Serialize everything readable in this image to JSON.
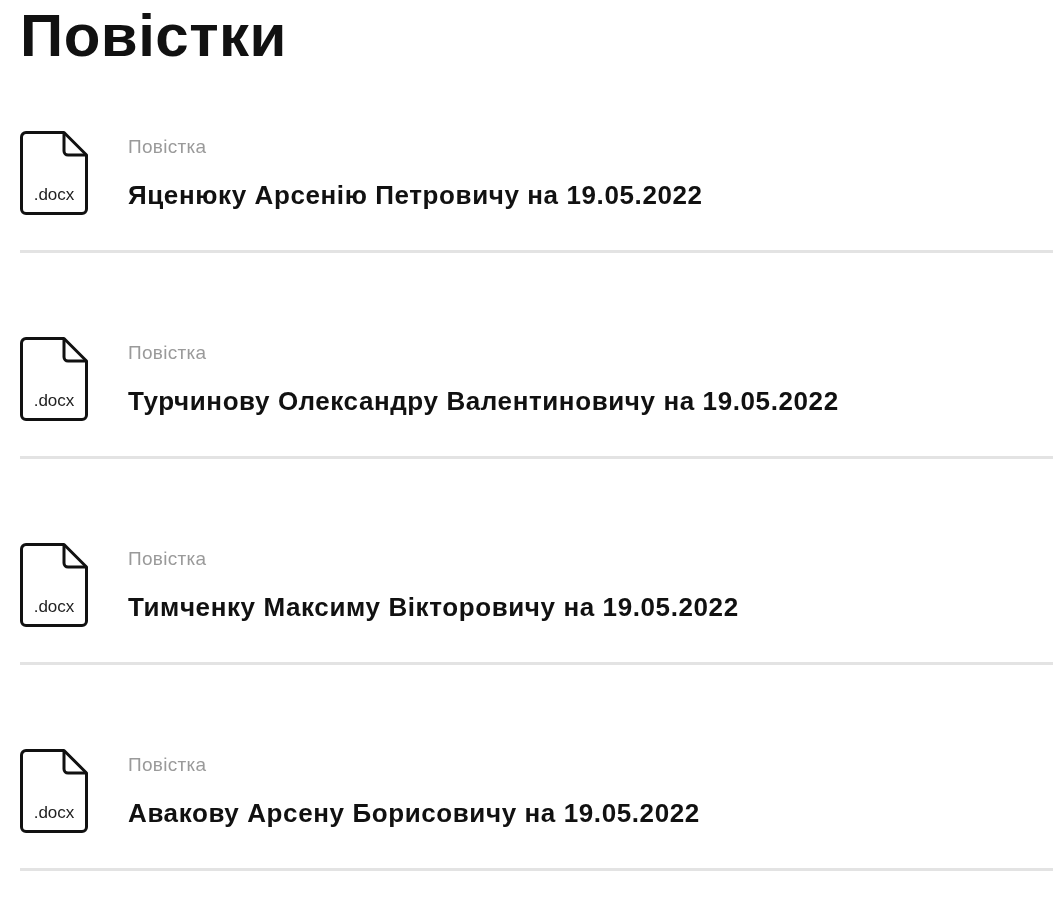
{
  "page": {
    "title": "Повістки"
  },
  "documents": [
    {
      "file_type": ".docx",
      "label": "Повістка",
      "name": "Яценюку Арсенію Петровичу на 19.05.2022"
    },
    {
      "file_type": ".docx",
      "label": "Повістка",
      "name": "Турчинову Олександру Валентиновичу на 19.05.2022"
    },
    {
      "file_type": ".docx",
      "label": "Повістка",
      "name": "Тимченку Максиму Вікторовичу на 19.05.2022"
    },
    {
      "file_type": ".docx",
      "label": "Повістка",
      "name": "Авакову Арсену Борисовичу на 19.05.2022"
    }
  ]
}
